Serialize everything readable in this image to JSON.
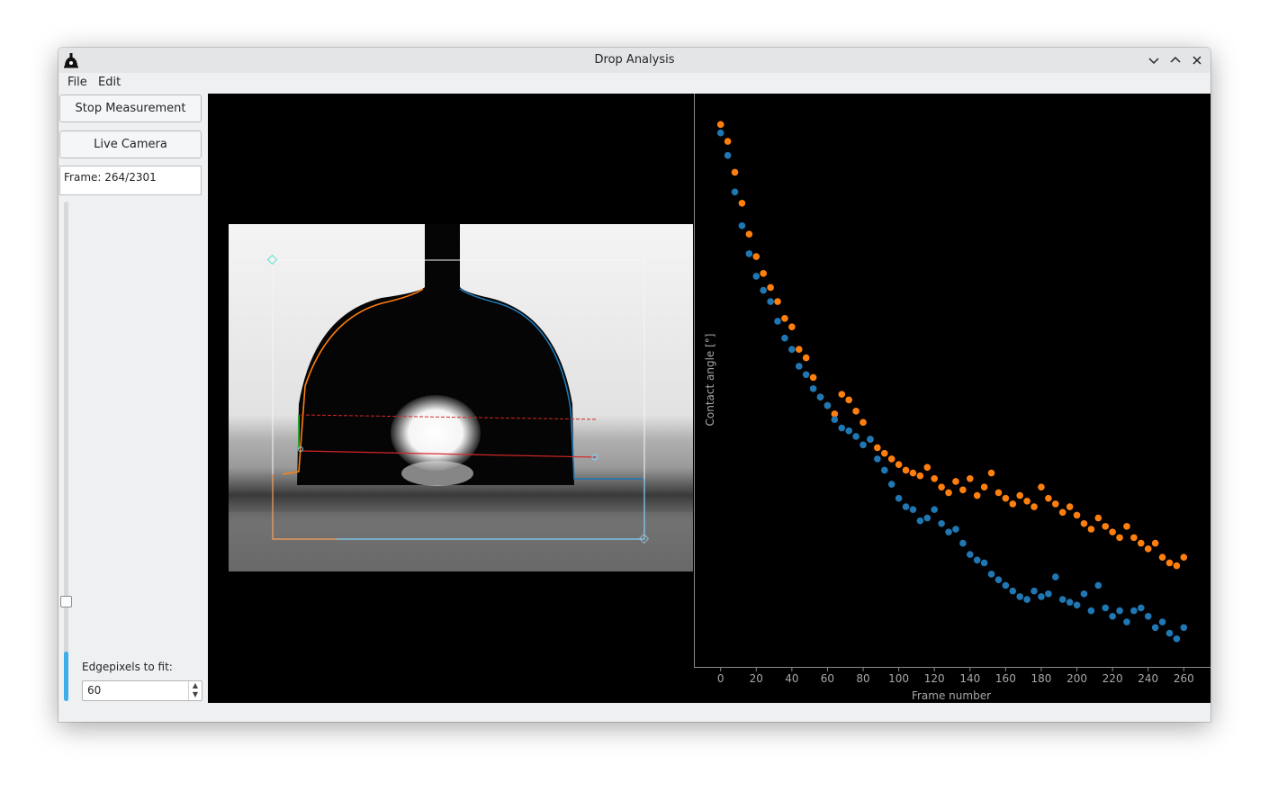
{
  "window": {
    "title": "Drop Analysis"
  },
  "menu": {
    "file": "File",
    "edit": "Edit"
  },
  "sidebar": {
    "stop_label": "Stop Measurement",
    "live_label": "Live Camera",
    "frame_label": "Frame: 264/2301",
    "frame_current": 264,
    "frame_total": 2301,
    "edge_label": "Edgepixels to fit:",
    "edge_value": "60"
  },
  "colors": {
    "series_left": "#ff7f0e",
    "series_right": "#1f77b4",
    "fit_line": "#d62728",
    "bg": "#000000"
  },
  "chart_data": {
    "type": "scatter",
    "xlabel": "Frame number",
    "ylabel": "Contact angle [°]",
    "xlim": [
      -15,
      275
    ],
    "ylim": [
      103.6,
      124.0
    ],
    "xticks": [
      0,
      20,
      40,
      60,
      80,
      100,
      120,
      140,
      160,
      180,
      200,
      220,
      240,
      260
    ],
    "yticks": [
      104,
      106,
      108,
      110,
      112,
      114,
      116,
      118,
      120,
      122
    ],
    "legend": "none",
    "grid": false,
    "series": [
      {
        "color": "#ff7f0e",
        "x": [
          0,
          4,
          8,
          12,
          16,
          20,
          24,
          28,
          32,
          36,
          40,
          44,
          48,
          52,
          56,
          60,
          64,
          68,
          72,
          76,
          80,
          84,
          88,
          92,
          96,
          100,
          104,
          108,
          112,
          116,
          120,
          124,
          128,
          132,
          136,
          140,
          144,
          148,
          152,
          156,
          160,
          164,
          168,
          172,
          176,
          180,
          184,
          188,
          192,
          196,
          200,
          204,
          208,
          212,
          216,
          220,
          224,
          228,
          232,
          236,
          240,
          244,
          248,
          252,
          256,
          260
        ],
        "y": [
          122.9,
          122.3,
          121.2,
          120.1,
          119.0,
          118.2,
          117.6,
          117.1,
          116.6,
          116.0,
          115.7,
          114.9,
          114.6,
          113.9,
          113.2,
          112.9,
          112.6,
          113.3,
          113.1,
          112.7,
          112.3,
          111.7,
          111.4,
          111.2,
          111.0,
          110.8,
          110.6,
          110.5,
          110.4,
          110.7,
          110.3,
          110.0,
          109.8,
          110.2,
          109.9,
          110.3,
          109.7,
          110.0,
          110.5,
          109.8,
          109.6,
          109.4,
          109.7,
          109.5,
          109.3,
          110.0,
          109.6,
          109.4,
          109.1,
          109.3,
          109.0,
          108.7,
          108.5,
          108.9,
          108.6,
          108.4,
          108.2,
          108.6,
          108.2,
          108.0,
          107.8,
          108.0,
          107.5,
          107.3,
          107.2,
          107.5
        ]
      },
      {
        "color": "#1f77b4",
        "x": [
          0,
          4,
          8,
          12,
          16,
          20,
          24,
          28,
          32,
          36,
          40,
          44,
          48,
          52,
          56,
          60,
          64,
          68,
          72,
          76,
          80,
          84,
          88,
          92,
          96,
          100,
          104,
          108,
          112,
          116,
          120,
          124,
          128,
          132,
          136,
          140,
          144,
          148,
          152,
          156,
          160,
          164,
          168,
          172,
          176,
          180,
          184,
          188,
          192,
          196,
          200,
          204,
          208,
          212,
          216,
          220,
          224,
          228,
          232,
          236,
          240,
          244,
          248,
          252,
          256,
          260
        ],
        "y": [
          122.6,
          121.8,
          120.5,
          119.3,
          118.3,
          117.5,
          117.0,
          116.6,
          115.9,
          115.3,
          114.9,
          114.3,
          114.0,
          113.5,
          113.2,
          112.9,
          112.4,
          112.1,
          112.0,
          111.8,
          111.5,
          111.7,
          111.0,
          110.6,
          110.1,
          109.6,
          109.3,
          109.2,
          108.8,
          108.9,
          109.2,
          108.7,
          108.4,
          108.5,
          108.0,
          107.6,
          107.4,
          107.3,
          106.9,
          106.7,
          106.5,
          106.3,
          106.1,
          106.0,
          106.3,
          106.1,
          106.2,
          106.8,
          106.0,
          105.9,
          105.8,
          106.2,
          105.6,
          106.5,
          105.7,
          105.4,
          105.6,
          105.2,
          105.6,
          105.7,
          105.4,
          105.0,
          105.2,
          104.8,
          104.6,
          105.0
        ]
      }
    ]
  }
}
